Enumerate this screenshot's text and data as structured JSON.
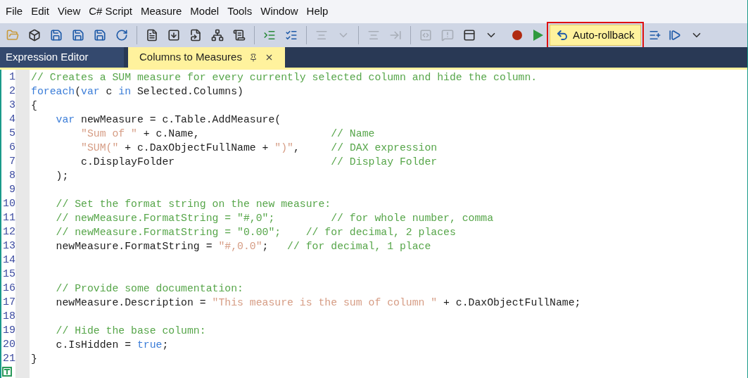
{
  "menu": [
    "File",
    "Edit",
    "View",
    "C# Script",
    "Measure",
    "Model",
    "Tools",
    "Window",
    "Help"
  ],
  "toolbar": {
    "rollback": {
      "label": "Auto-rollback",
      "highlighted": true
    }
  },
  "tabs": [
    {
      "label": "Expression Editor",
      "selected": false
    },
    {
      "label": "Columns to Measures",
      "selected": true
    }
  ],
  "code": [
    {
      "n": "1",
      "tokens": [
        {
          "kind": "comment",
          "text": "// Creates a SUM measure for every currently selected column and hide the column."
        }
      ]
    },
    {
      "n": "2",
      "tokens": [
        {
          "kind": "keyword",
          "text": "foreach"
        },
        {
          "kind": "plain",
          "text": "("
        },
        {
          "kind": "keyword",
          "text": "var"
        },
        {
          "kind": "plain",
          "text": " c "
        },
        {
          "kind": "keyword",
          "text": "in"
        },
        {
          "kind": "plain",
          "text": " Selected.Columns)"
        }
      ]
    },
    {
      "n": "3",
      "tokens": [
        {
          "kind": "plain",
          "text": "{"
        }
      ]
    },
    {
      "n": "4",
      "tokens": [
        {
          "kind": "keyword",
          "text": "    var"
        },
        {
          "kind": "plain",
          "text": " newMeasure = c.Table.AddMeasure("
        }
      ]
    },
    {
      "n": "5",
      "tokens": [
        {
          "kind": "string",
          "text": "        \"Sum of \""
        },
        {
          "kind": "plain",
          "text": " + c.Name,                     "
        },
        {
          "kind": "comment",
          "text": "// Name"
        }
      ]
    },
    {
      "n": "6",
      "tokens": [
        {
          "kind": "string",
          "text": "        \"SUM(\""
        },
        {
          "kind": "plain",
          "text": " + c.DaxObjectFullName + "
        },
        {
          "kind": "string",
          "text": "\")\""
        },
        {
          "kind": "plain",
          "text": ",     "
        },
        {
          "kind": "comment",
          "text": "// DAX expression"
        }
      ]
    },
    {
      "n": "7",
      "tokens": [
        {
          "kind": "plain",
          "text": "        c.DisplayFolder                         "
        },
        {
          "kind": "comment",
          "text": "// Display Folder"
        }
      ]
    },
    {
      "n": "8",
      "tokens": [
        {
          "kind": "plain",
          "text": "    );"
        }
      ]
    },
    {
      "n": "9"
    },
    {
      "n": "10",
      "tokens": [
        {
          "kind": "comment",
          "text": "    // Set the format string on the new measure:"
        }
      ]
    },
    {
      "n": "11",
      "tokens": [
        {
          "kind": "comment",
          "text": "    // newMeasure.FormatString = \"#,0\";         // for whole number, comma"
        }
      ]
    },
    {
      "n": "12",
      "tokens": [
        {
          "kind": "comment",
          "text": "    // newMeasure.FormatString = \"0.00\";    // for decimal, 2 places"
        }
      ]
    },
    {
      "n": "13",
      "tokens": [
        {
          "kind": "plain",
          "text": "    newMeasure.FormatString = "
        },
        {
          "kind": "string",
          "text": "\"#,0.0\""
        },
        {
          "kind": "plain",
          "text": ";   "
        },
        {
          "kind": "comment",
          "text": "// for decimal, 1 place"
        }
      ]
    },
    {
      "n": "14"
    },
    {
      "n": "15"
    },
    {
      "n": "16",
      "tokens": [
        {
          "kind": "comment",
          "text": "    // Provide some documentation:"
        }
      ]
    },
    {
      "n": "17",
      "tokens": [
        {
          "kind": "plain",
          "text": "    newMeasure.Description = "
        },
        {
          "kind": "string",
          "text": "\"This measure is the sum of column \""
        },
        {
          "kind": "plain",
          "text": " + c.DaxObjectFullName;"
        }
      ]
    },
    {
      "n": "18"
    },
    {
      "n": "19",
      "tokens": [
        {
          "kind": "comment",
          "text": "    // Hide the base column:"
        }
      ]
    },
    {
      "n": "20",
      "tokens": [
        {
          "kind": "plain",
          "text": "    c.IsHidden = "
        },
        {
          "kind": "keyword",
          "text": "true"
        },
        {
          "kind": "plain",
          "text": ";"
        }
      ]
    },
    {
      "n": "21",
      "tokens": [
        {
          "kind": "plain",
          "text": "}"
        }
      ]
    }
  ]
}
